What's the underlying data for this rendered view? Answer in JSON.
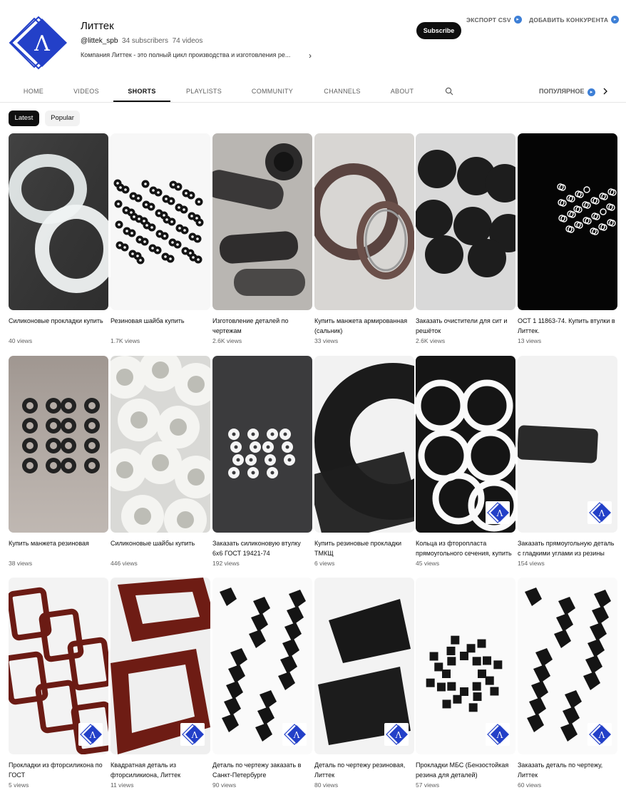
{
  "channel": {
    "name": "Литтек",
    "handle": "@littek_spb",
    "subscribers": "34 subscribers",
    "videos": "74 videos",
    "description": "Компания Литтек - это полный цикл производства и изготовления ре...",
    "subscribe_label": "Subscribe",
    "avatar_icon": "littek-logo-icon",
    "logo_letter": "Λ"
  },
  "extensions": {
    "export_label": "ЭКСПОРТ CSV",
    "competitor_label": "ДОБАВИТЬ КОНКУРЕНТА"
  },
  "tabs": [
    {
      "label": "HOME"
    },
    {
      "label": "VIDEOS"
    },
    {
      "label": "SHORTS",
      "active": true
    },
    {
      "label": "PLAYLISTS"
    },
    {
      "label": "COMMUNITY"
    },
    {
      "label": "CHANNELS"
    },
    {
      "label": "ABOUT"
    }
  ],
  "sort_label": "ПОПУЛЯРНОЕ",
  "chips": [
    {
      "label": "Latest",
      "selected": true
    },
    {
      "label": "Popular",
      "selected": false
    }
  ],
  "colors": {
    "brand_blue": "#2340c8",
    "accent_blue": "#3d7fd6",
    "dark": "#0f0f0f"
  },
  "shorts": [
    {
      "title": "Силиконовые прокладки купить",
      "views": "40 views",
      "thumb": "clear-silicone-rings"
    },
    {
      "title": "Резиновая шайба купить",
      "views": "1.7K views",
      "thumb": "black-rubber-washers"
    },
    {
      "title": "Изготовление деталей по чертежам",
      "views": "2.6K views",
      "thumb": "black-metal-tubes"
    },
    {
      "title": "Купить манжета армированная (сальник)",
      "views": "33 views",
      "thumb": "brown-oil-seals"
    },
    {
      "title": "Заказать очистители для сит и решёток",
      "views": "2.6K views",
      "thumb": "black-rubber-balls"
    },
    {
      "title": "ОСТ 1 11863-74. Купить втулки в Литтек.",
      "views": "13 views",
      "thumb": "white-small-rings"
    },
    {
      "title": "Купить манжета резиновая",
      "views": "38 views",
      "thumb": "black-small-seals"
    },
    {
      "title": "Силиконовые шайбы купить",
      "views": "446 views",
      "thumb": "white-silicone-bushings"
    },
    {
      "title": "Заказать силиконовую втулку 6х6 ГОСТ 19421-74",
      "views": "192 views",
      "thumb": "white-small-bushings"
    },
    {
      "title": "Купить резиновые прокладки ТМКЩ",
      "views": "6 views",
      "thumb": "black-flange-gasket"
    },
    {
      "title": "Кольца из фторопласта прямоугольного сечения, купить",
      "views": "45 views",
      "thumb": "white-ptfe-rings"
    },
    {
      "title": "Заказать прямоугольную деталь с гладкими углами из резины",
      "views": "154 views",
      "thumb": "black-rectangle-part"
    },
    {
      "title": "Прокладки из фторсиликона по ГОСТ",
      "views": "5 views",
      "thumb": "red-frame-gaskets"
    },
    {
      "title": "Квадратная деталь из фторсиликиона, Литтек",
      "views": "11 views",
      "thumb": "red-square-frames"
    },
    {
      "title": "Деталь по чертежу заказать в Санкт-Петербурге",
      "views": "90 views",
      "thumb": "black-v-parts"
    },
    {
      "title": "Деталь по чертежу резиновая, Литтек",
      "views": "80 views",
      "thumb": "black-angle-parts"
    },
    {
      "title": "Прокладки МБС (Бензостойкая резина для деталей)",
      "views": "57 views",
      "thumb": "black-pattern-parts"
    },
    {
      "title": "Заказать деталь по чертежу, Литтек",
      "views": "60 views",
      "thumb": "black-corner-parts"
    }
  ]
}
